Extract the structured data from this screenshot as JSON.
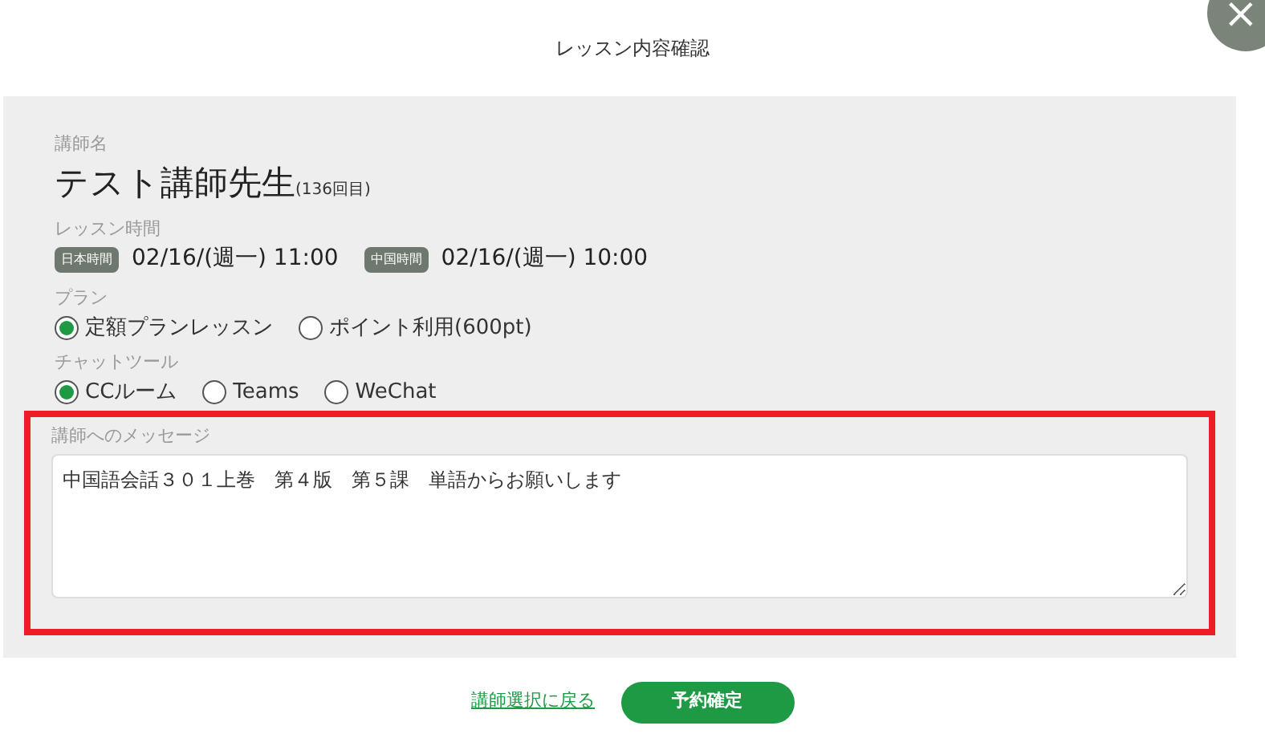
{
  "dialog": {
    "title": "レッスン内容確認",
    "close": "×"
  },
  "teacher": {
    "label": "講師名",
    "name": "テスト講師先生",
    "count": "(136回目)"
  },
  "lesson_time": {
    "label": "レッスン時間",
    "times": [
      {
        "badge": "日本時間",
        "value": "02/16/(週一) 11:00"
      },
      {
        "badge": "中国時間",
        "value": "02/16/(週一) 10:00"
      }
    ]
  },
  "plan": {
    "label": "プラン",
    "options": [
      {
        "label": "定額プランレッスン",
        "selected": true
      },
      {
        "label": "ポイント利用(600pt)",
        "selected": false
      }
    ]
  },
  "chat_tool": {
    "label": "チャットツール",
    "options": [
      {
        "label": "CCルーム",
        "selected": true
      },
      {
        "label": "Teams",
        "selected": false
      },
      {
        "label": "WeChat",
        "selected": false
      }
    ]
  },
  "message": {
    "label": "講師へのメッセージ",
    "value": "中国語会話３０１上巻　第４版　第５課　単語からお願いします",
    "highlighted": true
  },
  "footer": {
    "back_link": "講師選択に戻る",
    "confirm_button": "予約確定"
  }
}
